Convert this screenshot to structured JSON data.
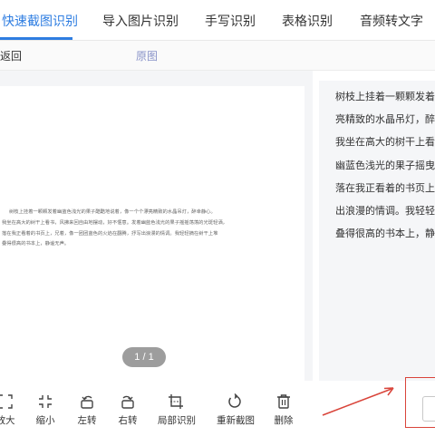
{
  "tabs": [
    "快速截图识别",
    "导入图片识别",
    "手写识别",
    "表格识别",
    "音频转文字"
  ],
  "active_tab": 0,
  "subbar": {
    "back_label": "返回",
    "original_label": "原图"
  },
  "doc": {
    "lines": [
      "树枝上挂着一颗颗发着幽蓝色浅光的果子酷酷地说着，像一个个漂亮精致的水晶吊灯，醉幸静心。",
      "我坐在高大的树干上看书，风拂来回自由地摆动，好不惬意。发着幽蓝色浅光的果子摇摇荡荡的光斑轻洒，",
      "落在我正看着的书页上，兄着，像一团团蓝色的火焰在翻腾，抒写出浪漫的情调。我轻轻摘在树干上堆",
      "叠得很高的书本上，静谧无声。"
    ],
    "page_indicator": "1 / 1"
  },
  "result_text": [
    "树枝上挂着一颗颗发着幽",
    "亮精致的水晶吊灯，醉幸",
    "我坐在高大的树干上看书",
    "幽蓝色浅光的果子摇曳的",
    "落在我正看着的书页上，",
    "出浪漫的情调。我轻轻摘",
    "叠得很高的书本上，静谧"
  ],
  "toolbar": [
    {
      "label": "放大",
      "icon": "zoom-in-icon"
    },
    {
      "label": "缩小",
      "icon": "zoom-out-icon"
    },
    {
      "label": "左转",
      "icon": "rotate-left-icon"
    },
    {
      "label": "右转",
      "icon": "rotate-right-icon"
    },
    {
      "label": "局部识别",
      "icon": "crop-recognize-icon"
    },
    {
      "label": "重新截图",
      "icon": "recapture-icon"
    },
    {
      "label": "删除",
      "icon": "trash-icon"
    }
  ],
  "colors": {
    "accent": "#2e7de1",
    "annotation": "#d9443a"
  }
}
